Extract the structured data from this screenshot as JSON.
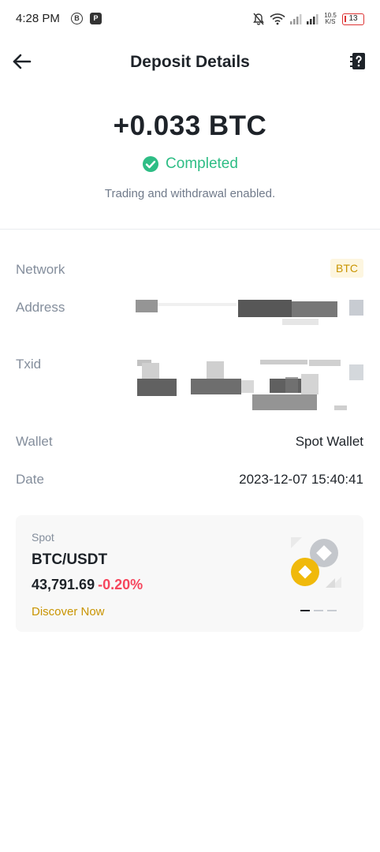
{
  "status_bar": {
    "time": "4:28 PM",
    "app_icon_1": "B",
    "app_icon_2": "P",
    "net_speed_value": "10.5",
    "net_speed_unit": "K/S",
    "battery": "13"
  },
  "header": {
    "title": "Deposit Details",
    "back_icon": "arrow-left-icon",
    "help_icon": "help-document-icon"
  },
  "summary": {
    "amount": "+0.033 BTC",
    "status": "Completed",
    "status_color": "#2ebd85",
    "note": "Trading and withdrawal enabled."
  },
  "details": {
    "network_label": "Network",
    "network_value": "BTC",
    "address_label": "Address",
    "txid_label": "Txid",
    "wallet_label": "Wallet",
    "wallet_value": "Spot Wallet",
    "date_label": "Date",
    "date_value": "2023-12-07 15:40:41"
  },
  "promo": {
    "label": "Spot",
    "pair": "BTC/USDT",
    "price": "43,791.69",
    "change": "-0.20%",
    "change_color": "#f6465d",
    "link": "Discover Now",
    "link_color": "#c99400"
  },
  "colors": {
    "accent_yellow": "#f0b90b",
    "text_primary": "#1e2329",
    "text_secondary": "#848e9c"
  }
}
